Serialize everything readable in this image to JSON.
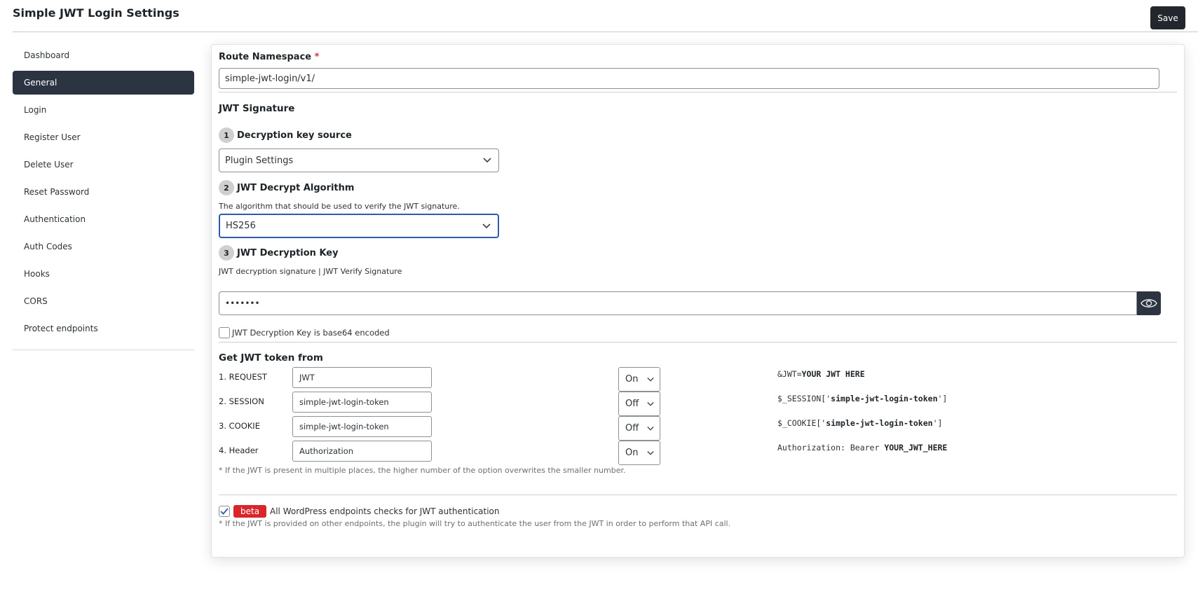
{
  "header": {
    "title": "Simple JWT Login Settings",
    "save_label": "Save"
  },
  "sidebar": {
    "items": [
      {
        "label": "Dashboard",
        "active": false
      },
      {
        "label": "General",
        "active": true
      },
      {
        "label": "Login",
        "active": false
      },
      {
        "label": "Register User",
        "active": false
      },
      {
        "label": "Delete User",
        "active": false
      },
      {
        "label": "Reset Password",
        "active": false
      },
      {
        "label": "Authentication",
        "active": false
      },
      {
        "label": "Auth Codes",
        "active": false
      },
      {
        "label": "Hooks",
        "active": false
      },
      {
        "label": "CORS",
        "active": false
      },
      {
        "label": "Protect endpoints",
        "active": false
      }
    ]
  },
  "route_namespace": {
    "label": "Route Namespace",
    "required_mark": "*",
    "value": "simple-jwt-login/v1/"
  },
  "jwt_signature": {
    "title": "JWT Signature",
    "step1": {
      "num": "1",
      "label": "Decryption key source",
      "selected": "Plugin Settings"
    },
    "step2": {
      "num": "2",
      "label": "JWT Decrypt Algorithm",
      "help": "The algorithm that should be used to verify the JWT signature.",
      "selected": "HS256"
    },
    "step3": {
      "num": "3",
      "label": "JWT Decryption Key",
      "help": "JWT decryption signature | JWT Verify Signature",
      "value": "•••••••",
      "toggle_icon": "eye-icon"
    },
    "base64": {
      "label": "JWT Decryption Key is base64 encoded",
      "checked": false
    }
  },
  "token_from": {
    "title": "Get JWT token from",
    "rows": [
      {
        "label": "1. REQUEST",
        "value": "JWT",
        "state": "On",
        "code_prefix": "&JWT=",
        "code_bold": "YOUR JWT HERE",
        "code_suffix": ""
      },
      {
        "label": "2. SESSION",
        "value": "simple-jwt-login-token",
        "state": "Off",
        "code_prefix": "$_SESSION['",
        "code_bold": "simple-jwt-login-token",
        "code_suffix": "']"
      },
      {
        "label": "3. COOKIE",
        "value": "simple-jwt-login-token",
        "state": "Off",
        "code_prefix": "$_COOKIE['",
        "code_bold": "simple-jwt-login-token",
        "code_suffix": "']"
      },
      {
        "label": "4. Header",
        "value": "Authorization",
        "state": "On",
        "code_prefix": "Authorization: Bearer ",
        "code_bold": "YOUR_JWT_HERE",
        "code_suffix": ""
      }
    ],
    "note": "* If the JWT is present in multiple places, the higher number of the option overwrites the smaller number."
  },
  "all_endpoints": {
    "checked": true,
    "badge": "beta",
    "label": "All WordPress endpoints checks for JWT authentication",
    "note": "* If the JWT is provided on other endpoints, the plugin will try to authenticate the user from the JWT in order to perform that API call."
  },
  "colors": {
    "primary_dark": "#2c3442",
    "beta_red": "#d9262a",
    "focus_blue": "#2f5bab"
  }
}
